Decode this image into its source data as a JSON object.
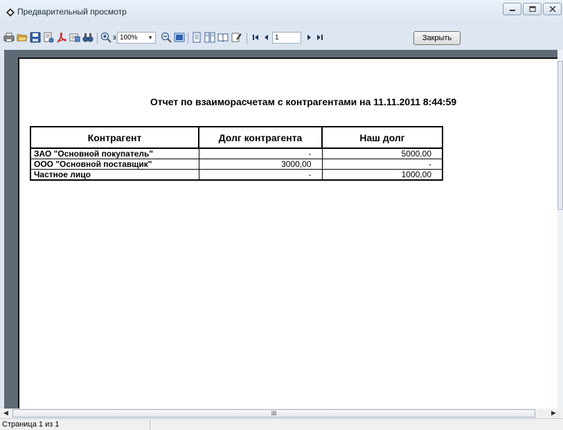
{
  "window": {
    "title": "Предварительный просмотр"
  },
  "toolbar": {
    "zoom_value": "100%",
    "page_number": "1",
    "close_label": "Закрыть"
  },
  "report": {
    "title": "Отчет по взаиморасчетам с контрагентами на  11.11.2011 8:44:59",
    "columns": [
      "Контрагент",
      "Долг контрагента",
      "Наш долг"
    ],
    "rows": [
      {
        "name": "ЗАО \"Основной покупатель\"",
        "their_debt": "-",
        "our_debt": "5000,00"
      },
      {
        "name": "ООО \"Основной поставщик\"",
        "their_debt": "3000,00",
        "our_debt": "-"
      },
      {
        "name": "Частное лицо",
        "their_debt": "-",
        "our_debt": "1000,00"
      }
    ]
  },
  "scrollbar": {
    "h_thumb_grip": "III"
  },
  "status": {
    "page_info": "Страница 1 из 1"
  }
}
